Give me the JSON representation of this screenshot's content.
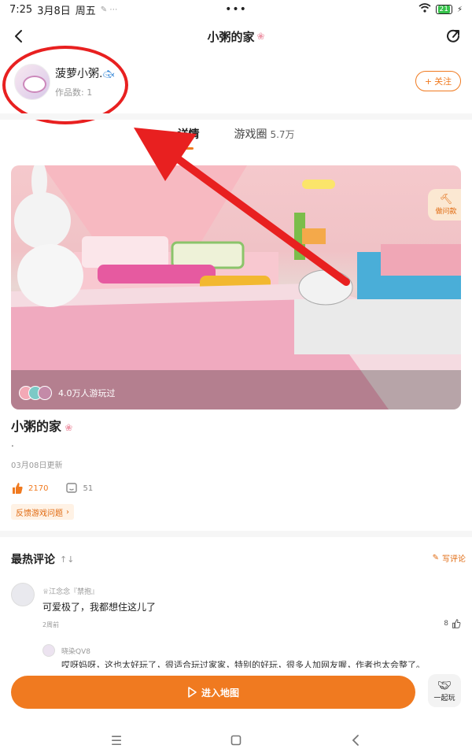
{
  "status": {
    "time": "7:25",
    "date": "3月8日",
    "weekday": "周五",
    "center_dots": "•••",
    "battery": "21"
  },
  "header": {
    "title": "小粥的家"
  },
  "author": {
    "name": "菠萝小粥.",
    "works": "作品数: 1",
    "follow_label": "关注"
  },
  "tabs": [
    {
      "label": "详情"
    },
    {
      "label": "游戏圈",
      "count": "5.7万"
    }
  ],
  "scene": {
    "plays": "4.0万人游玩过",
    "ask_label": "做问款"
  },
  "game": {
    "title": "小粥的家",
    "desc": ".",
    "updated": "03月08日更新",
    "likes": "2170",
    "comments": "51",
    "feedback": "反馈游戏问题"
  },
  "comments": {
    "title": "最热评论",
    "sort_icon": "↑↓",
    "write": "写评论",
    "items": [
      {
        "user": "江念念『禁抱』",
        "text": "可爱极了，我都想住这儿了",
        "time": "2周前",
        "likes": "8"
      }
    ],
    "reply": {
      "user": "晓染QV8",
      "text": "哎呀妈呀，这也太好玩了，很适合玩过家家，特别的好玩，很多人加网友喔，作者也太会整了。"
    }
  },
  "actions": {
    "enter": "进入地图",
    "together": "一起玩"
  }
}
